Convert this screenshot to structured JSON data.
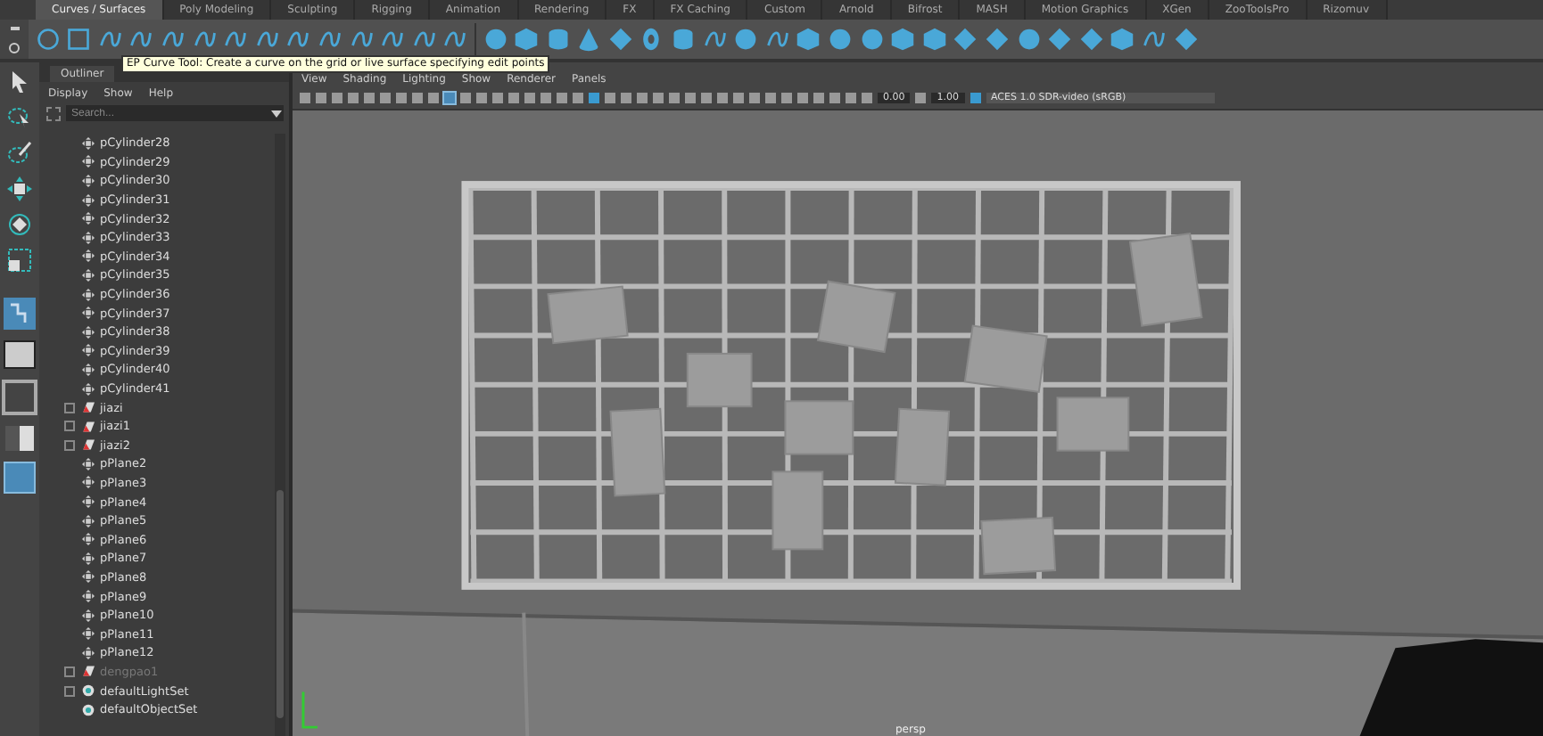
{
  "shelf": {
    "tabs": [
      {
        "label": "Curves / Surfaces",
        "selected": true
      },
      {
        "label": "Poly Modeling",
        "selected": false
      },
      {
        "label": "Sculpting",
        "selected": false
      },
      {
        "label": "Rigging",
        "selected": false
      },
      {
        "label": "Animation",
        "selected": false
      },
      {
        "label": "Rendering",
        "selected": false
      },
      {
        "label": "FX",
        "selected": false
      },
      {
        "label": "FX Caching",
        "selected": false
      },
      {
        "label": "Custom",
        "selected": false
      },
      {
        "label": "Arnold",
        "selected": false
      },
      {
        "label": "Bifrost",
        "selected": false
      },
      {
        "label": "MASH",
        "selected": false
      },
      {
        "label": "Motion Graphics",
        "selected": false
      },
      {
        "label": "XGen",
        "selected": false
      },
      {
        "label": "ZooToolsPro",
        "selected": false
      },
      {
        "label": "Rizomuv",
        "selected": false
      }
    ],
    "tooltip": "EP Curve Tool: Create a curve on the grid or live surface specifying edit points"
  },
  "outliner": {
    "tab": "Outliner",
    "menus": [
      "Display",
      "Show",
      "Help"
    ],
    "search": {
      "placeholder": "Search..."
    },
    "items": [
      {
        "name": "pCylinder28",
        "kind": "transform",
        "hidden": false,
        "expandable": false
      },
      {
        "name": "pCylinder29",
        "kind": "transform",
        "hidden": false,
        "expandable": false
      },
      {
        "name": "pCylinder30",
        "kind": "transform",
        "hidden": false,
        "expandable": false
      },
      {
        "name": "pCylinder31",
        "kind": "transform",
        "hidden": false,
        "expandable": false
      },
      {
        "name": "pCylinder32",
        "kind": "transform",
        "hidden": false,
        "expandable": false
      },
      {
        "name": "pCylinder33",
        "kind": "transform",
        "hidden": false,
        "expandable": false
      },
      {
        "name": "pCylinder34",
        "kind": "transform",
        "hidden": false,
        "expandable": false
      },
      {
        "name": "pCylinder35",
        "kind": "transform",
        "hidden": false,
        "expandable": false
      },
      {
        "name": "pCylinder36",
        "kind": "transform",
        "hidden": false,
        "expandable": false
      },
      {
        "name": "pCylinder37",
        "kind": "transform",
        "hidden": false,
        "expandable": false
      },
      {
        "name": "pCylinder38",
        "kind": "transform",
        "hidden": false,
        "expandable": false
      },
      {
        "name": "pCylinder39",
        "kind": "transform",
        "hidden": false,
        "expandable": false
      },
      {
        "name": "pCylinder40",
        "kind": "transform",
        "hidden": false,
        "expandable": false
      },
      {
        "name": "pCylinder41",
        "kind": "transform",
        "hidden": false,
        "expandable": false
      },
      {
        "name": "jiazi",
        "kind": "group",
        "hidden": false,
        "expandable": true
      },
      {
        "name": "jiazi1",
        "kind": "group",
        "hidden": false,
        "expandable": true
      },
      {
        "name": "jiazi2",
        "kind": "group",
        "hidden": false,
        "expandable": true
      },
      {
        "name": "pPlane2",
        "kind": "transform",
        "hidden": false,
        "expandable": false
      },
      {
        "name": "pPlane3",
        "kind": "transform",
        "hidden": false,
        "expandable": false
      },
      {
        "name": "pPlane4",
        "kind": "transform",
        "hidden": false,
        "expandable": false
      },
      {
        "name": "pPlane5",
        "kind": "transform",
        "hidden": false,
        "expandable": false
      },
      {
        "name": "pPlane6",
        "kind": "transform",
        "hidden": false,
        "expandable": false
      },
      {
        "name": "pPlane7",
        "kind": "transform",
        "hidden": false,
        "expandable": false
      },
      {
        "name": "pPlane8",
        "kind": "transform",
        "hidden": false,
        "expandable": false
      },
      {
        "name": "pPlane9",
        "kind": "transform",
        "hidden": false,
        "expandable": false
      },
      {
        "name": "pPlane10",
        "kind": "transform",
        "hidden": false,
        "expandable": false
      },
      {
        "name": "pPlane11",
        "kind": "transform",
        "hidden": false,
        "expandable": false
      },
      {
        "name": "pPlane12",
        "kind": "transform",
        "hidden": false,
        "expandable": false
      },
      {
        "name": "dengpao1",
        "kind": "group",
        "hidden": true,
        "expandable": true
      },
      {
        "name": "defaultLightSet",
        "kind": "set",
        "hidden": false,
        "expandable": true
      },
      {
        "name": "defaultObjectSet",
        "kind": "set",
        "hidden": false,
        "expandable": false
      }
    ]
  },
  "viewport": {
    "menus": [
      "View",
      "Shading",
      "Lighting",
      "Show",
      "Renderer",
      "Panels"
    ],
    "exposure": "0.00",
    "gamma": "1.00",
    "color_space": "ACES 1.0 SDR-video (sRGB)",
    "camera": "persp"
  }
}
